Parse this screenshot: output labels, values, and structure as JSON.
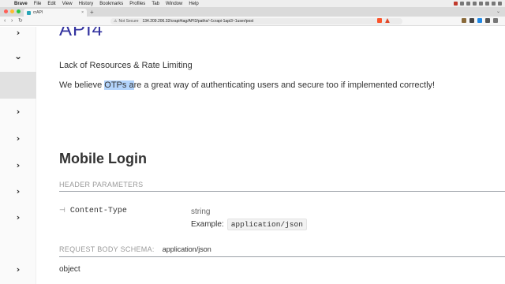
{
  "menubar": {
    "items": [
      "Brave",
      "File",
      "Edit",
      "View",
      "History",
      "Bookmarks",
      "Profiles",
      "Tab",
      "Window",
      "Help"
    ]
  },
  "tab": {
    "title": "crAPI",
    "close": "×"
  },
  "toolbar": {
    "security_label": "Not Secure",
    "url": "134.209.206.32/crapi#tag/API3/paths/~1crapi-1api3~1user/post"
  },
  "sidebar": {
    "items": [
      {
        "icon": "chevron-right-icon",
        "glyph": "›"
      },
      {
        "icon": "chevron-down-icon",
        "glyph": "⌄"
      },
      {
        "icon": "",
        "glyph": ""
      },
      {
        "icon": "chevron-right-icon",
        "glyph": "›"
      },
      {
        "icon": "chevron-right-icon",
        "glyph": "›"
      },
      {
        "icon": "chevron-right-icon",
        "glyph": "›"
      },
      {
        "icon": "chevron-right-icon",
        "glyph": "›"
      },
      {
        "icon": "chevron-right-icon",
        "glyph": "›"
      },
      {
        "icon": "chevron-right-icon",
        "glyph": "›"
      }
    ]
  },
  "content": {
    "section_heading": "API4",
    "lack_text": "Lack of Resources & Rate Limiting",
    "believe_before": "We believe ",
    "believe_highlight": "OTPs a",
    "believe_after": "re a great way of authenticating users and secure too if implemented correctly!",
    "operation_title": "Mobile Login",
    "header_params_label": "HEADER PARAMETERS",
    "param_name": "Content-Type",
    "param_type": "string",
    "example_label": "Example:",
    "example_value": "application/json",
    "request_body_label": "REQUEST BODY SCHEMA:",
    "request_body_type": "application/json",
    "object_label": "object"
  },
  "colors": {
    "heading_accent": "#32329f",
    "highlight": "#b3d4fc",
    "sidebar_active": "#e1e1e1"
  }
}
